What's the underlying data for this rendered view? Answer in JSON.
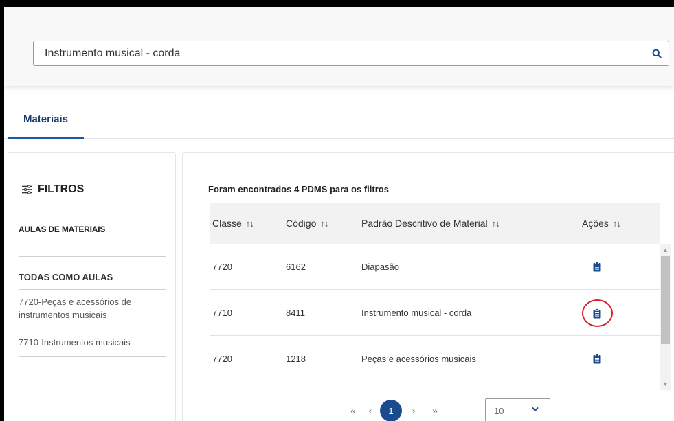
{
  "search": {
    "value": "Instrumento musical - corda"
  },
  "tabs": [
    {
      "label": "Materiais",
      "active": true
    }
  ],
  "filters": {
    "title": "FILTROS",
    "subtitle": "AULAS DE MATERIAIS",
    "all_label": "TODAS COMO AULAS",
    "items": [
      {
        "label": "7720-Peças e acessórios de instrumentos musicais"
      },
      {
        "label": "7710-Instrumentos musicais"
      }
    ]
  },
  "results": {
    "summary": "Foram encontrados 4 PDMS para os filtros",
    "columns": [
      {
        "label": "Classe"
      },
      {
        "label": "Código"
      },
      {
        "label": "Padrão Descritivo de Material"
      },
      {
        "label": "Ações"
      }
    ],
    "rows": [
      {
        "classe": "7720",
        "codigo": "6162",
        "descricao": "Diapasão",
        "action_icon": "clipboard-icon",
        "highlighted": false
      },
      {
        "classe": "7710",
        "codigo": "8411",
        "descricao": "Instrumento musical - corda",
        "action_icon": "clipboard-icon",
        "highlighted": true
      },
      {
        "classe": "7720",
        "codigo": "1218",
        "descricao": "Peças e acessórios musicais",
        "action_icon": "clipboard-icon",
        "highlighted": false
      }
    ]
  },
  "pagination": {
    "first": "«",
    "prev": "‹",
    "current": "1",
    "next": "›",
    "last": "»",
    "page_size": "10"
  },
  "colors": {
    "accent": "#1b4b8f",
    "tab_underline": "#1b5aa8",
    "highlight": "#d9202a",
    "icon": "#1b4b8f"
  }
}
